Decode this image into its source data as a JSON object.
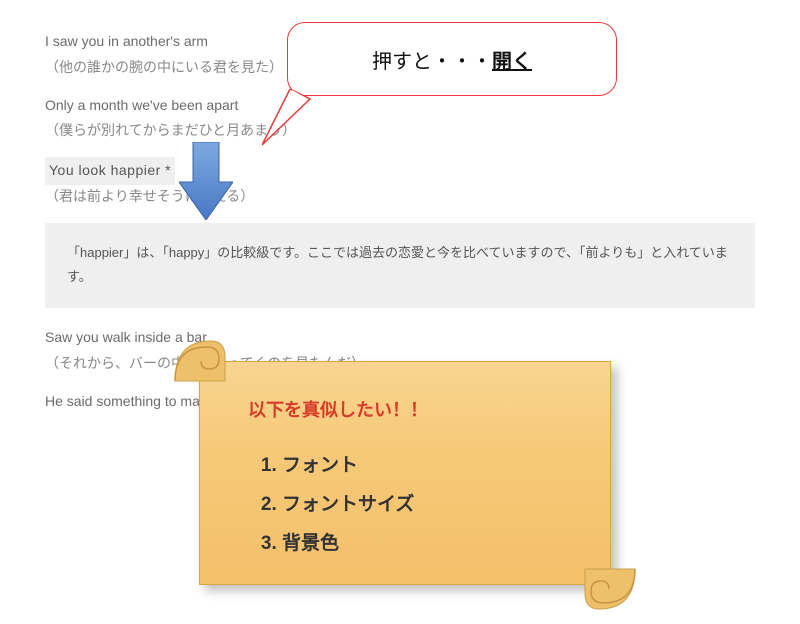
{
  "lyrics": {
    "l1_en": "I saw you in another's arm",
    "l1_ja": "（他の誰かの腕の中にいる君を見た）",
    "l2_en": "Only a month we've been apart",
    "l2_ja": "（僕らが別れてからまだひと月あまり）",
    "l3_en": "You look happier *",
    "l3_ja": "（君は前より幸せそうに見える）",
    "l4_en": "Saw you walk inside a bar",
    "l4_ja": "（それから、バーの中へと入ってくのを見たんだ）",
    "l5_en": "He said something to make you laugh"
  },
  "note": "「happier」は、「happy」の比較級です。ここでは過去の恋愛と今を比べていますので、「前よりも」と入れています。",
  "callout": {
    "pre": "押すと・・・",
    "strong": "開く"
  },
  "scroll": {
    "title": "以下を真似したい！！",
    "items": [
      "フォント",
      "フォントサイズ",
      "背景色"
    ]
  }
}
